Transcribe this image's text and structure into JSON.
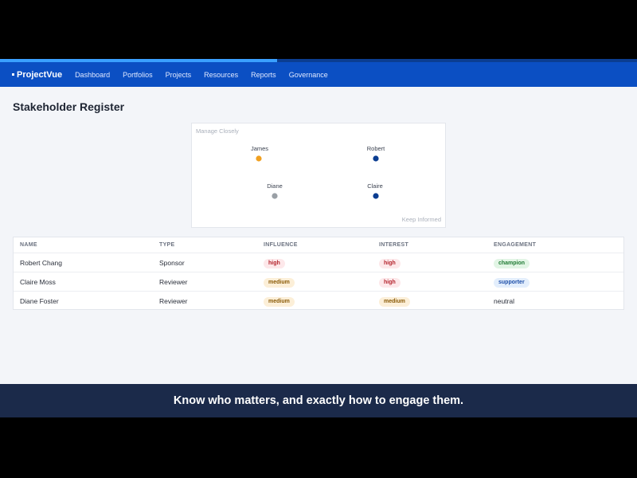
{
  "video": {
    "progress": 0.435
  },
  "navbar": {
    "brand": "ProjectVue",
    "items": [
      "Dashboard",
      "Portfolios",
      "Projects",
      "Resources",
      "Reports",
      "Governance"
    ]
  },
  "page": {
    "title": "Stakeholder Register"
  },
  "matrix": {
    "top_left_label": "Manage Closely",
    "bottom_right_label": "Keep Informed",
    "points": [
      {
        "name": "James",
        "color": "#f0a020"
      },
      {
        "name": "Robert",
        "color": "#0b3d91"
      },
      {
        "name": "Diane",
        "color": "#9aa0a6"
      },
      {
        "name": "Claire",
        "color": "#0b3d91"
      }
    ]
  },
  "table": {
    "headers": [
      "NAME",
      "TYPE",
      "INFLUENCE",
      "INTEREST",
      "ENGAGEMENT"
    ],
    "rows": [
      {
        "name": "Robert Chang",
        "type": "Sponsor",
        "influence": "high",
        "interest": "high",
        "engagement": "champion"
      },
      {
        "name": "Claire Moss",
        "type": "Reviewer",
        "influence": "medium",
        "interest": "high",
        "engagement": "supporter"
      },
      {
        "name": "Diane Foster",
        "type": "Reviewer",
        "influence": "medium",
        "interest": "medium",
        "engagement": "neutral"
      }
    ]
  },
  "caption": "Know who matters, and exactly how to engage them."
}
